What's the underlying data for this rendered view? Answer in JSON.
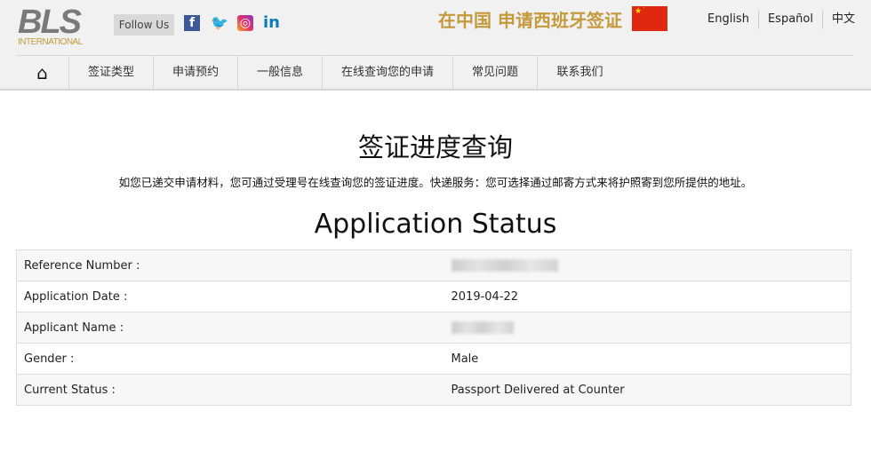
{
  "header": {
    "logo_text": "BLS",
    "logo_sub": "INTERNATIONAL",
    "follow_us": "Follow Us",
    "social": [
      {
        "icon": "facebook-icon",
        "glyph": "f"
      },
      {
        "icon": "twitter-icon",
        "glyph": "🐦"
      },
      {
        "icon": "instagram-icon",
        "glyph": "◎"
      },
      {
        "icon": "linkedin-icon",
        "glyph": "in"
      }
    ],
    "slogan": "在中国 申请西班牙签证",
    "flag_stars": "★˙",
    "languages": [
      "English",
      "Español",
      "中文"
    ]
  },
  "nav": {
    "home_icon": "⌂",
    "items": [
      "签证类型",
      "申请预约",
      "一般信息",
      "在线查询您的申请",
      "常见问题",
      "联系我们"
    ]
  },
  "main": {
    "title": "签证进度查询",
    "description": "如您已递交申请材料，您可通过受理号在线查询您的签证进度。快递服务：您可选择通过邮寄方式来将护照寄到您所提供的地址。",
    "status_title": "Application Status",
    "rows": [
      {
        "label": "Reference Number :",
        "value": null
      },
      {
        "label": "Application Date :",
        "value": "2019-04-22"
      },
      {
        "label": "Applicant Name :",
        "value": null
      },
      {
        "label": "Gender :",
        "value": "Male"
      },
      {
        "label": "Current Status :",
        "value": "Passport Delivered at Counter"
      }
    ]
  }
}
